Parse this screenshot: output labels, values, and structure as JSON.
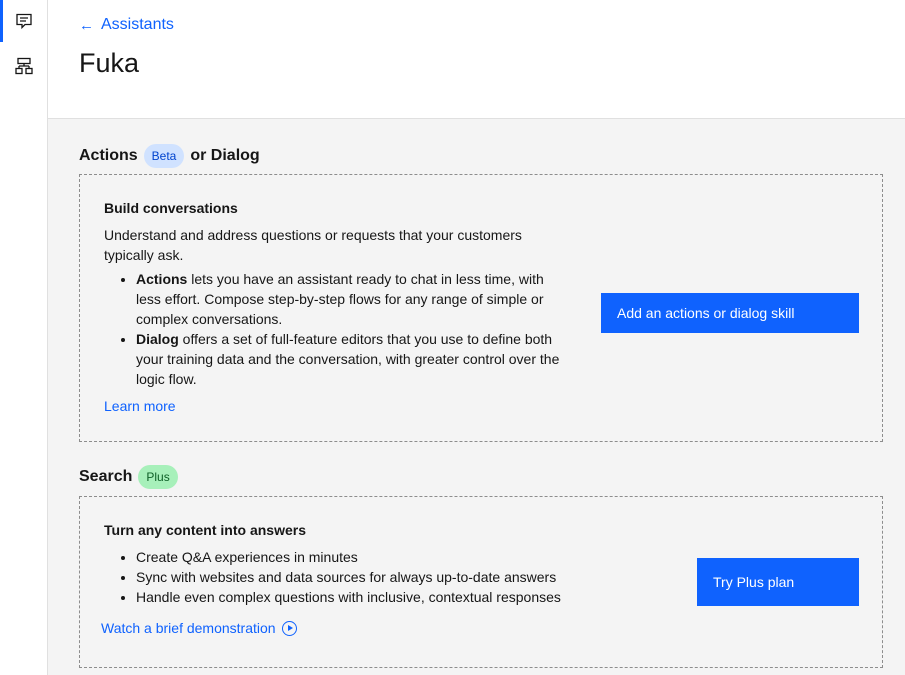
{
  "rail": {
    "items": [
      {
        "name": "chat-icon",
        "active": true
      },
      {
        "name": "flow-icon",
        "active": false
      }
    ]
  },
  "header": {
    "back_label": "Assistants",
    "title": "Fuka"
  },
  "actions_section": {
    "title_prefix": "Actions",
    "tag": "Beta",
    "title_suffix": "or Dialog",
    "card": {
      "heading": "Build conversations",
      "description": "Understand and address questions or requests that your customers typically ask.",
      "bullets": [
        {
          "bold": "Actions",
          "text": " lets you have an assistant ready to chat in less time, with less effort. Compose step-by-step flows for any range of simple or complex conversations."
        },
        {
          "bold": "Dialog",
          "text": " offers a set of full-feature editors that you use to define both your training data and the conversation, with greater control over the logic flow."
        }
      ],
      "link": "Learn more",
      "button": "Add an actions or dialog skill"
    }
  },
  "search_section": {
    "title": "Search",
    "tag": "Plus",
    "card": {
      "heading": "Turn any content into answers",
      "bullets": [
        "Create Q&A experiences in minutes",
        "Sync with websites and data sources for always up-to-date answers",
        "Handle even complex questions with inclusive, contextual responses"
      ],
      "link": "Watch a brief demonstration",
      "button": "Try Plus plan"
    }
  }
}
